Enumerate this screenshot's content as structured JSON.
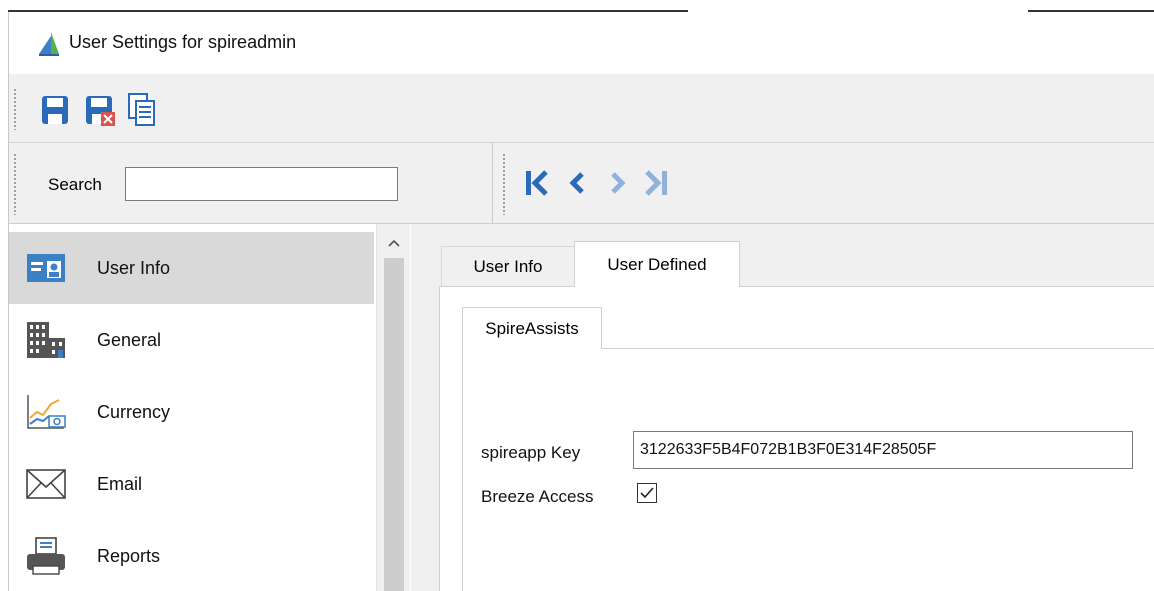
{
  "window": {
    "title": "User Settings for spireadmin"
  },
  "toolbar": {
    "buttons": [
      {
        "icon": "save-icon",
        "color": "#2a6ab8"
      },
      {
        "icon": "save-close-icon",
        "color": "#2a6ab8"
      },
      {
        "icon": "copy-icon",
        "color": "#2a6ab8"
      }
    ]
  },
  "navbar": {
    "search_label": "Search",
    "search_value": "",
    "nav_buttons": [
      {
        "icon": "first-record-icon",
        "color": "#2a6ab8"
      },
      {
        "icon": "previous-record-icon",
        "color": "#2a6ab8"
      },
      {
        "icon": "next-record-icon",
        "color": "#8fb1dc"
      },
      {
        "icon": "last-record-icon",
        "color": "#8fb1dc"
      }
    ]
  },
  "sidebar": {
    "items": [
      {
        "label": "User Info",
        "icon": "user-card-icon",
        "selected": true
      },
      {
        "label": "General",
        "icon": "building-icon",
        "selected": false
      },
      {
        "label": "Currency",
        "icon": "currency-chart-icon",
        "selected": false
      },
      {
        "label": "Email",
        "icon": "envelope-icon",
        "selected": false
      },
      {
        "label": "Reports",
        "icon": "printer-icon",
        "selected": false
      }
    ]
  },
  "main": {
    "tabs": [
      {
        "label": "User Info",
        "active": false
      },
      {
        "label": "User Defined",
        "active": true
      }
    ],
    "subtab": {
      "label": "SpireAssists"
    },
    "fields": {
      "spireapp_key_label": "spireapp Key",
      "spireapp_key_value": "3122633F5B4F072B1B3F0E314F28505F",
      "breeze_access_label": "Breeze Access",
      "breeze_access_checked": true
    }
  },
  "colors": {
    "accent_blue": "#2a6ab8",
    "accent_blue_disabled": "#8fb1dc",
    "selected_bg": "#d9d9d9"
  }
}
